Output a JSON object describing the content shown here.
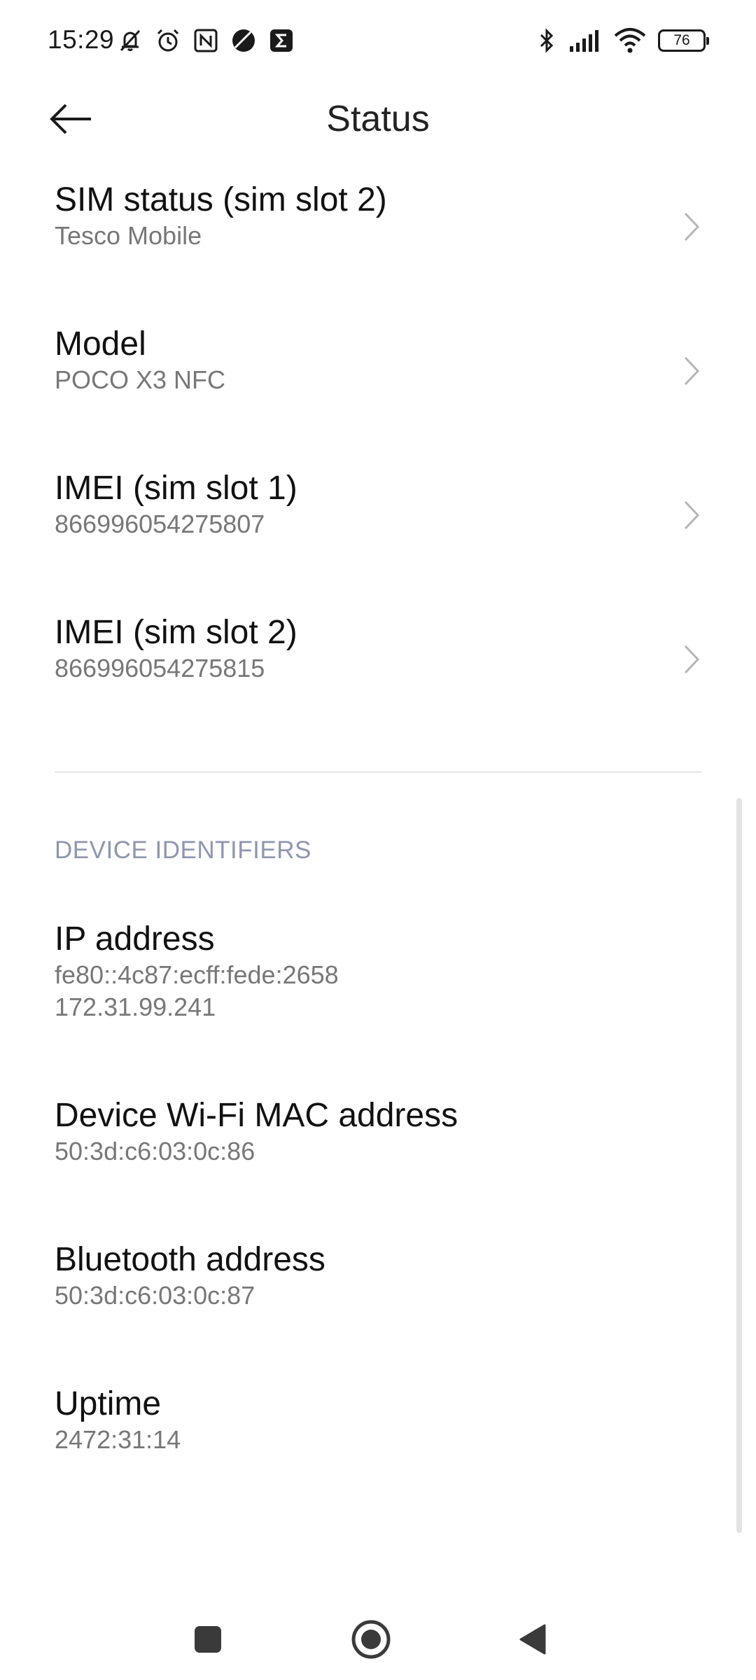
{
  "status_bar": {
    "time": "15:29",
    "battery_level": "76",
    "left_icons": [
      "bell-off-icon",
      "alarm-icon",
      "nfc-icon",
      "app-icon",
      "sigma-icon"
    ],
    "right_icons": [
      "bluetooth-icon",
      "signal-icon",
      "wifi-icon",
      "battery-icon"
    ]
  },
  "header": {
    "title": "Status",
    "back_icon": "arrow-left-icon"
  },
  "items_top": [
    {
      "title": "SIM status (sim slot 2)",
      "subtitle": "Tesco Mobile",
      "has_chevron": true
    },
    {
      "title": "Model",
      "subtitle": "POCO X3 NFC",
      "has_chevron": true
    },
    {
      "title": "IMEI (sim slot 1)",
      "subtitle": "866996054275807",
      "has_chevron": true
    },
    {
      "title": "IMEI (sim slot 2)",
      "subtitle": "866996054275815",
      "has_chevron": true
    }
  ],
  "section": {
    "label": "DEVICE IDENTIFIERS"
  },
  "items_bottom": [
    {
      "title": "IP address",
      "subtitle": "fe80::4c87:ecff:fede:2658\n172.31.99.241"
    },
    {
      "title": "Device Wi-Fi MAC address",
      "subtitle": "50:3d:c6:03:0c:86"
    },
    {
      "title": "Bluetooth address",
      "subtitle": "50:3d:c6:03:0c:87"
    },
    {
      "title": "Uptime",
      "subtitle": "2472:31:14"
    }
  ],
  "nav_bar": {
    "buttons": [
      "recents-square-icon",
      "home-circle-icon",
      "back-triangle-icon"
    ]
  },
  "colors": {
    "section_label": "#8f96ad",
    "subtitle": "#777777",
    "chevron": "#b5b5b5"
  }
}
